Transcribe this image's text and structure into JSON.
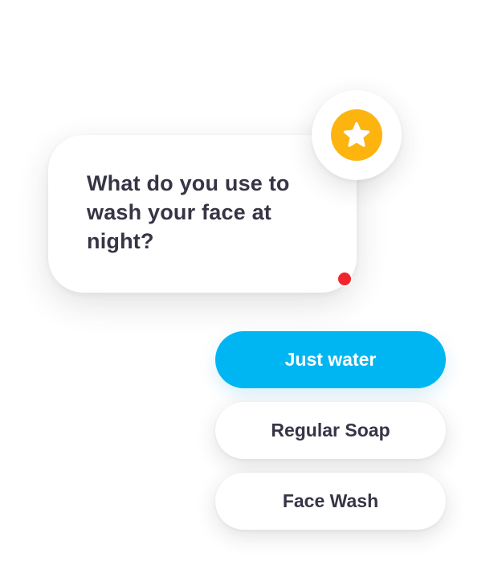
{
  "question": {
    "text": "What do you use to wash your face at night?"
  },
  "badge": {
    "icon": "star-icon",
    "color": "#FDB40F"
  },
  "status_dot": {
    "color": "#F0252C"
  },
  "options": [
    {
      "label": "Just water",
      "selected": true,
      "color": "#00B6F2"
    },
    {
      "label": "Regular Soap",
      "selected": false
    },
    {
      "label": "Face Wash",
      "selected": false
    }
  ]
}
